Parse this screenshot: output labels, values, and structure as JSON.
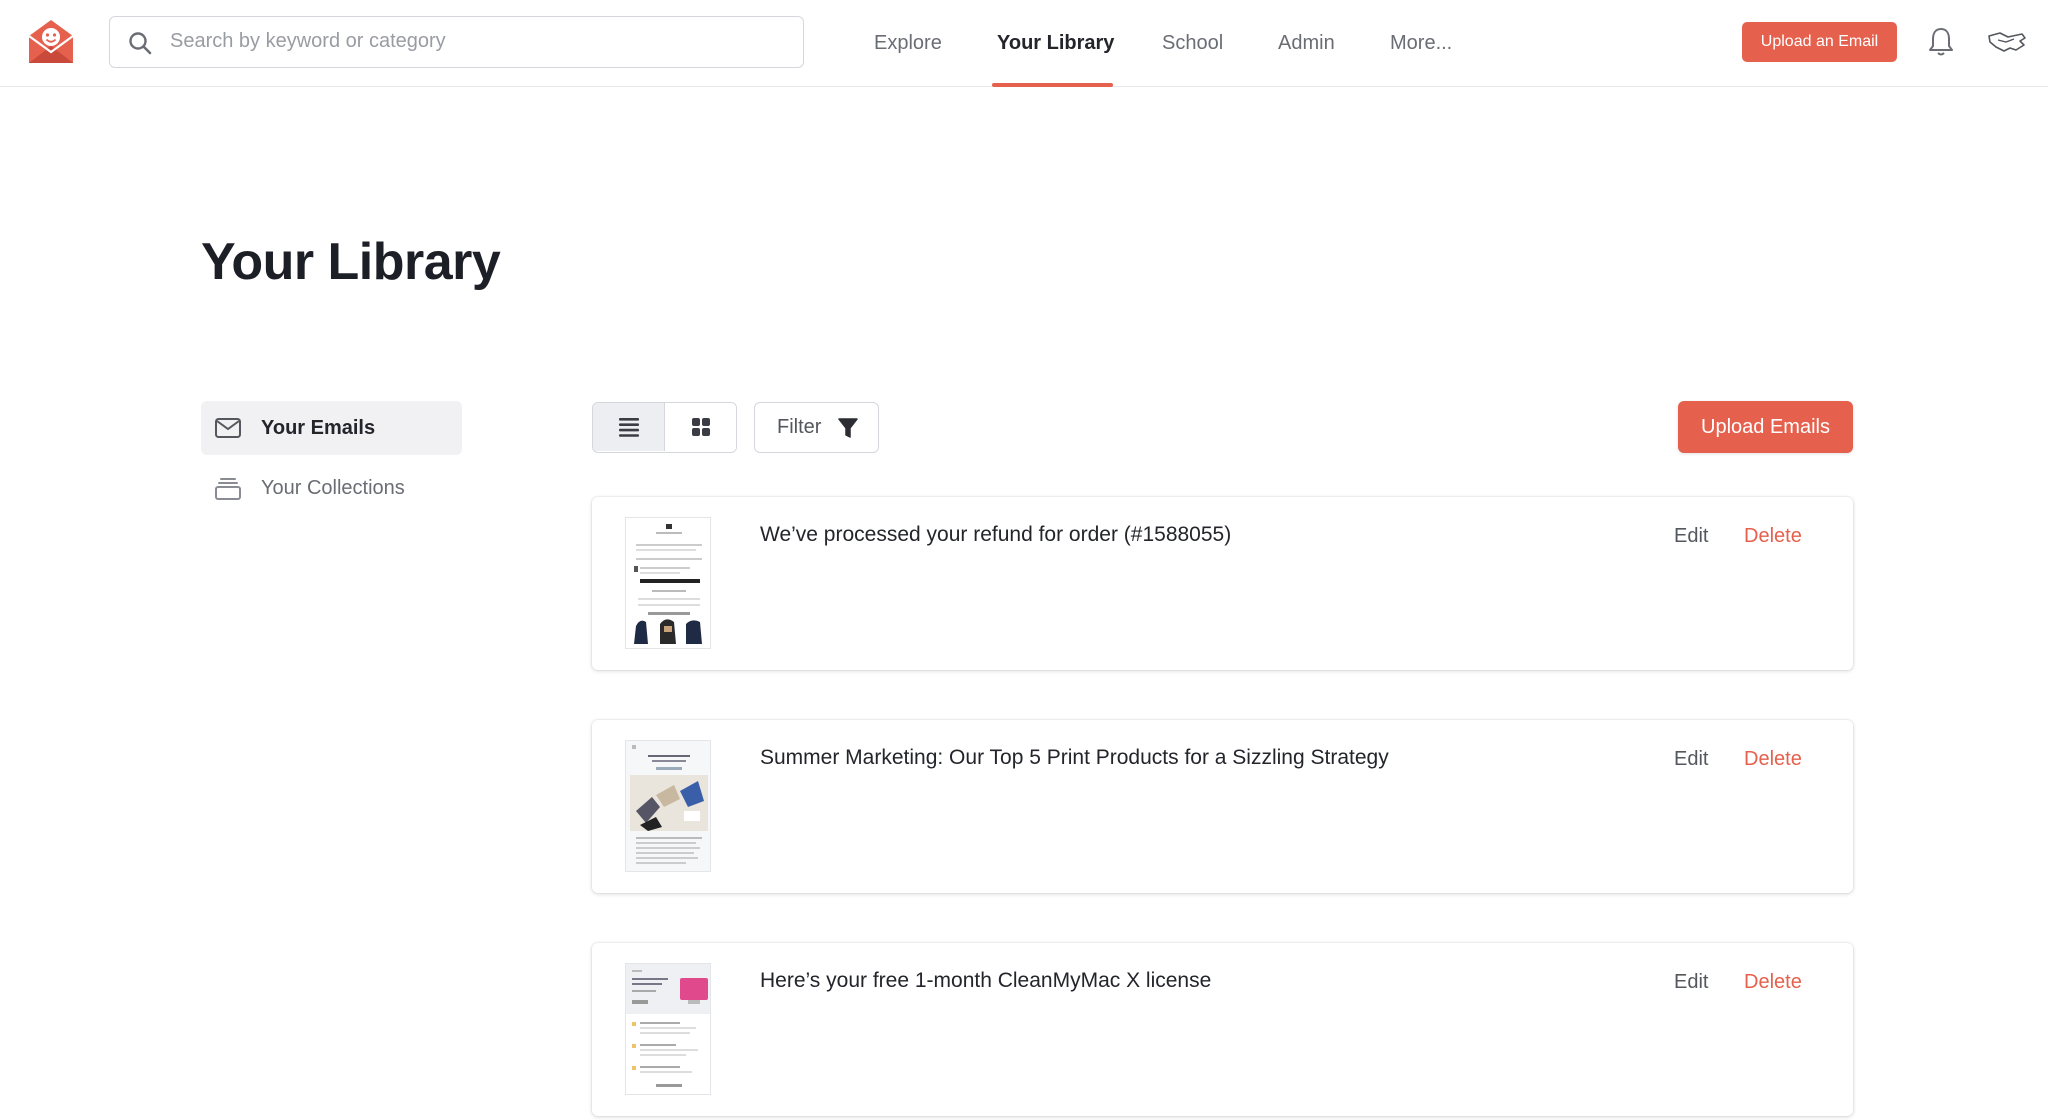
{
  "colors": {
    "accent": "#e5614e",
    "text": "#23252b",
    "muted": "#6b6d74"
  },
  "header": {
    "logo_icon": "envelope-smiley-logo",
    "search": {
      "placeholder": "Search by keyword or category",
      "value": ""
    },
    "nav": [
      {
        "label": "Explore",
        "active": false
      },
      {
        "label": "Your Library",
        "active": true
      },
      {
        "label": "School",
        "active": false
      },
      {
        "label": "Admin",
        "active": false
      },
      {
        "label": "More...",
        "active": false
      }
    ],
    "upload_button": "Upload an Email",
    "bell_icon": "bell-icon",
    "avatar_icon": "user-avatar"
  },
  "page": {
    "title": "Your Library"
  },
  "sidebar": {
    "items": [
      {
        "label": "Your Emails",
        "icon": "envelope-icon",
        "active": true
      },
      {
        "label": "Your Collections",
        "icon": "collection-icon",
        "active": false
      }
    ]
  },
  "toolbar": {
    "view_mode": "list",
    "filter_label": "Filter",
    "upload_button": "Upload Emails"
  },
  "emails": [
    {
      "title": "We’ve processed your refund for order (#1588055)",
      "edit": "Edit",
      "delete": "Delete"
    },
    {
      "title": "Summer Marketing: Our Top 5 Print Products for a Sizzling Strategy",
      "edit": "Edit",
      "delete": "Delete"
    },
    {
      "title": "Here’s your free 1-month CleanMyMac X license",
      "edit": "Edit",
      "delete": "Delete"
    }
  ]
}
